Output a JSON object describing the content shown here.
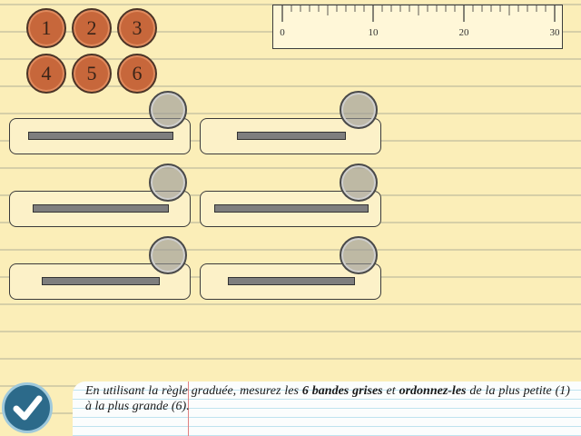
{
  "tokens": [
    "1",
    "2",
    "3",
    "4",
    "5",
    "6"
  ],
  "ruler": {
    "labels": [
      "0",
      "10",
      "20",
      "30"
    ],
    "max": 30
  },
  "strips": [
    {
      "length": 16
    },
    {
      "length": 12
    },
    {
      "length": 15
    },
    {
      "length": 17
    },
    {
      "length": 13
    },
    {
      "length": 14
    }
  ],
  "instruction": {
    "part1": "En utilisant la règle graduée, mesurez les ",
    "bold1": "6 bandes grises",
    "part2": " et ",
    "bold2": "ordonnez-les",
    "part3": " de la plus petite (1) à la plus grande (6)."
  },
  "icons": {
    "validate": "checkmark-icon"
  },
  "colors": {
    "background": "#fbeeb8",
    "token": "#c7673b",
    "strip": "#7e7e7e",
    "validate": "#2c6a8a"
  }
}
